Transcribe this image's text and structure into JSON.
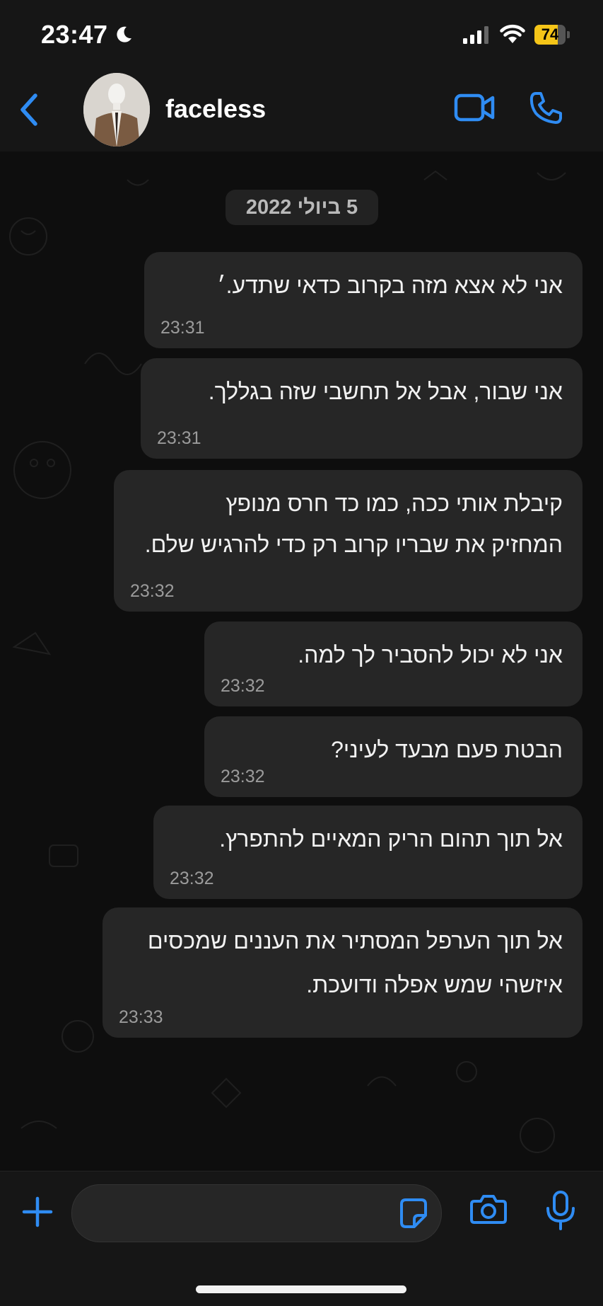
{
  "status_bar": {
    "time": "23:47",
    "focus_icon": "moon-icon",
    "signal_icon": "cellular-signal-icon",
    "wifi_icon": "wifi-icon",
    "battery_level": "74",
    "battery_percent": 74,
    "battery_color": "#f5c518"
  },
  "header": {
    "back_icon": "chevron-left-icon",
    "contact_name": "faceless",
    "avatar_icon": "contact-avatar",
    "video_call_icon": "video-camera-icon",
    "voice_call_icon": "phone-icon",
    "accent_color": "#2f8cf3"
  },
  "chat": {
    "date_separator": "5 ביולי 2022",
    "messages": [
      {
        "text_lines": [
          "אני לא אצא מזה בקרוב כדאי שתדע.׳"
        ],
        "time": "23:31"
      },
      {
        "text_lines": [
          "אני שבור, אבל אל תחשבי שזה בגללך."
        ],
        "time": "23:31"
      },
      {
        "text_lines": [
          "קיבלת אותי ככה, כמו כד חרס מנופץ",
          "המחזיק את שבריו קרוב רק כדי להרגיש שלם."
        ],
        "time": "23:32"
      },
      {
        "text_lines": [
          "אני לא יכול להסביר לך למה."
        ],
        "time": "23:32"
      },
      {
        "text_lines": [
          "הבטת פעם מבעד לעיני?"
        ],
        "time": "23:32"
      },
      {
        "text_lines": [
          "אל תוך תהום הריק המאיים להתפרץ."
        ],
        "time": "23:32"
      },
      {
        "text_lines": [
          "אל תוך הערפל המסתיר את העננים שמכסים",
          "איזשהי שמש אפלה ודועכת."
        ],
        "time": "23:33"
      }
    ]
  },
  "composer": {
    "attach_icon": "plus-icon",
    "message_value": "",
    "sticker_icon": "sticker-icon",
    "camera_icon": "camera-icon",
    "mic_icon": "microphone-icon"
  },
  "home_indicator_icon": "home-indicator"
}
